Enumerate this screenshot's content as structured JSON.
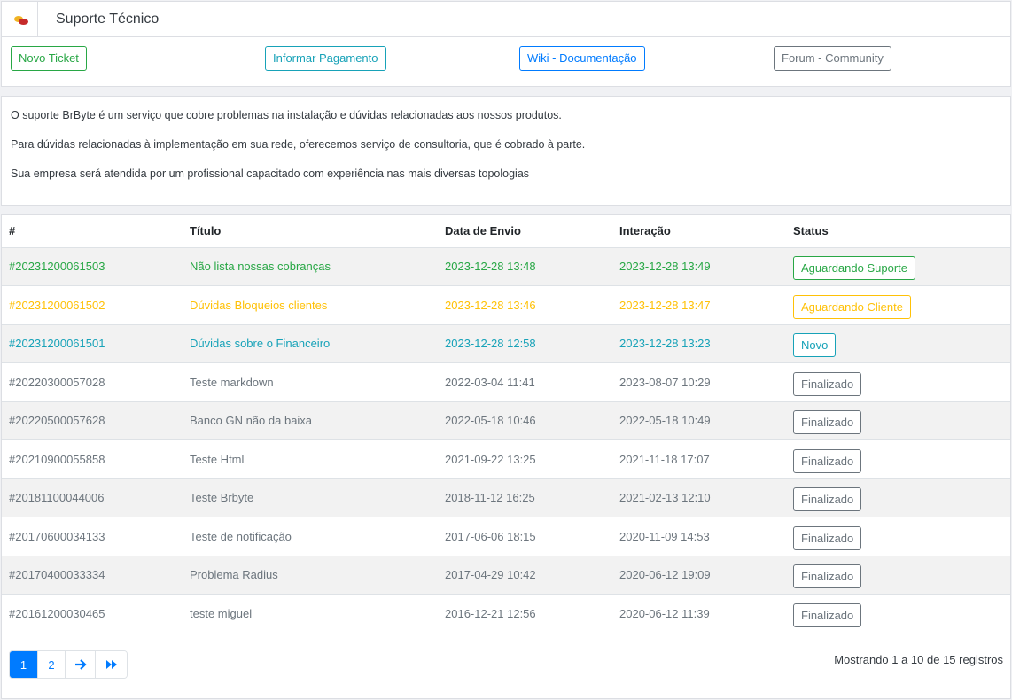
{
  "header": {
    "title": "Suporte Técnico",
    "logo": "brbyte-chat-bubbles-logo"
  },
  "actions": {
    "new_ticket": "Novo Ticket",
    "inform_payment": "Informar Pagamento",
    "wiki": "Wiki - Documentação",
    "forum": "Forum - Community"
  },
  "info": {
    "line1": "O suporte BrByte é um serviço que cobre problemas na instalação e dúvidas relacionadas aos nossos produtos.",
    "line2": "Para dúvidas relacionadas à implementação em sua rede, oferecemos serviço de consultoria, que é cobrado à parte.",
    "line3": "Sua empresa será atendida por um profissional capacitado com experiência nas mais diversas topologias"
  },
  "table": {
    "columns": [
      "#",
      "Título",
      "Data de Envio",
      "Interação",
      "Status"
    ],
    "rows": [
      {
        "id": "#20231200061503",
        "title": "Não lista nossas cobranças",
        "sent": "2023-12-28 13:48",
        "interaction": "2023-12-28 13:49",
        "status": "Aguardando Suporte",
        "variant": "success"
      },
      {
        "id": "#20231200061502",
        "title": "Dúvidas Bloqueios clientes",
        "sent": "2023-12-28 13:46",
        "interaction": "2023-12-28 13:47",
        "status": "Aguardando Cliente",
        "variant": "warning"
      },
      {
        "id": "#20231200061501",
        "title": "Dúvidas sobre o Financeiro",
        "sent": "2023-12-28 12:58",
        "interaction": "2023-12-28 13:23",
        "status": "Novo",
        "variant": "info"
      },
      {
        "id": "#20220300057028",
        "title": "Teste markdown",
        "sent": "2022-03-04 11:41",
        "interaction": "2023-08-07 10:29",
        "status": "Finalizado",
        "variant": "secondary"
      },
      {
        "id": "#20220500057628",
        "title": "Banco GN não da baixa",
        "sent": "2022-05-18 10:46",
        "interaction": "2022-05-18 10:49",
        "status": "Finalizado",
        "variant": "secondary"
      },
      {
        "id": "#20210900055858",
        "title": "Teste Html",
        "sent": "2021-09-22 13:25",
        "interaction": "2021-11-18 17:07",
        "status": "Finalizado",
        "variant": "secondary"
      },
      {
        "id": "#20181100044006",
        "title": "Teste Brbyte",
        "sent": "2018-11-12 16:25",
        "interaction": "2021-02-13 12:10",
        "status": "Finalizado",
        "variant": "secondary"
      },
      {
        "id": "#20170600034133",
        "title": "Teste de notificação",
        "sent": "2017-06-06 18:15",
        "interaction": "2020-11-09 14:53",
        "status": "Finalizado",
        "variant": "secondary"
      },
      {
        "id": "#20170400033334",
        "title": "Problema Radius",
        "sent": "2017-04-29 10:42",
        "interaction": "2020-06-12 19:09",
        "status": "Finalizado",
        "variant": "secondary"
      },
      {
        "id": "#20161200030465",
        "title": "teste miguel",
        "sent": "2016-12-21 12:56",
        "interaction": "2020-06-12 11:39",
        "status": "Finalizado",
        "variant": "secondary"
      }
    ]
  },
  "pagination": {
    "pages": [
      "1",
      "2"
    ],
    "current": "1",
    "next_icon": "arrow-right-icon",
    "last_icon": "fast-forward-icon",
    "summary": "Mostrando 1 a 10 de 15 registros"
  },
  "colors": {
    "success": "#28a745",
    "warning": "#ffc107",
    "info": "#17a2b8",
    "primary": "#007bff",
    "secondary": "#6c757d"
  }
}
